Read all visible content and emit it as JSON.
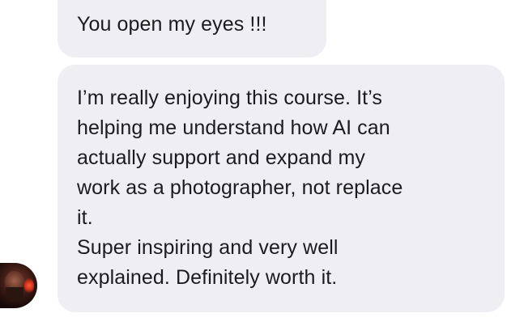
{
  "messages": [
    {
      "text": "You open my eyes !!!"
    },
    {
      "paragraphs": [
        "I’m really enjoying this course. It’s\nhelping me understand how AI can\nactually support and expand my\nwork as a photographer, not replace\nit.",
        "Super inspiring and very well\nexplained. Definitely worth it."
      ]
    }
  ],
  "colors": {
    "bubble_background": "#eeeef3",
    "text": "#1c1c1e",
    "page_background": "#ffffff"
  },
  "sender": {
    "avatar_icon": "user-avatar-photo"
  }
}
